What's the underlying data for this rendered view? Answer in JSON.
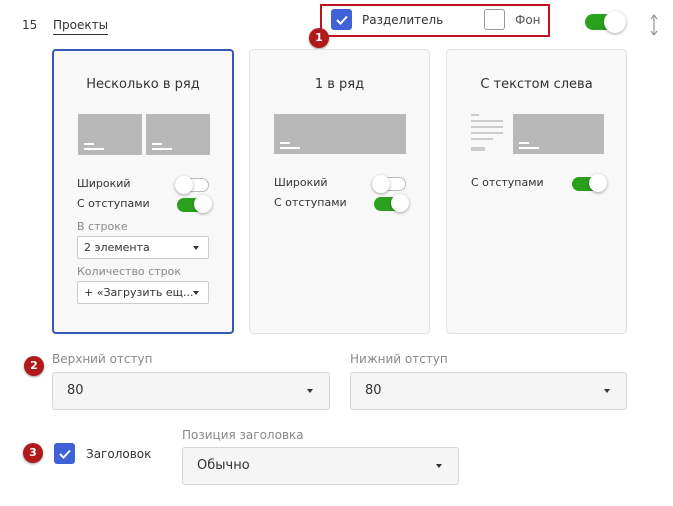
{
  "header": {
    "row_number": "15",
    "section_title": "Проекты",
    "separator_label": "Разделитель",
    "background_label": "Фон"
  },
  "markers": [
    "1",
    "2",
    "3"
  ],
  "cards": [
    {
      "title": "Несколько в ряд",
      "wide_label": "Широкий",
      "padding_label": "С отступами",
      "per_row_label": "В строке",
      "per_row_value": "2 элемента",
      "rows_count_label": "Количество строк",
      "rows_count_value": "+ «Загрузить ещ..."
    },
    {
      "title": "1 в ряд",
      "wide_label": "Широкий",
      "padding_label": "С отступами"
    },
    {
      "title": "С текстом слева",
      "padding_label": "С отступами"
    }
  ],
  "padding": {
    "top_label": "Верхний отступ",
    "top_value": "80",
    "bottom_label": "Нижний отступ",
    "bottom_value": "80"
  },
  "heading": {
    "checkbox_label": "Заголовок",
    "position_label": "Позиция заголовка",
    "position_value": "Обычно"
  },
  "colors": {
    "accent": "#3f62d6",
    "toggle_on": "#2aa01c",
    "marker": "#b01a1a",
    "highlight_border": "#c0121d"
  }
}
